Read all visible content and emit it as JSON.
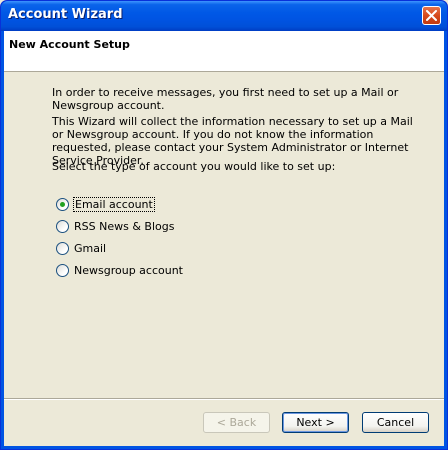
{
  "window": {
    "title": "Account Wizard"
  },
  "header": {
    "title": "New Account Setup"
  },
  "body": {
    "paragraph1": "In order to receive messages, you first need to set up a Mail or Newsgroup account.",
    "paragraph2": "This Wizard will collect the information necessary to set up a Mail or Newsgroup account. If you do not know the information requested, please contact your System Administrator or Internet Service Provider.",
    "prompt": "Select the type of account you would like to set up:"
  },
  "account_types": [
    {
      "label": "Email account",
      "selected": true
    },
    {
      "label": "RSS News & Blogs",
      "selected": false
    },
    {
      "label": "Gmail",
      "selected": false
    },
    {
      "label": "Newsgroup account",
      "selected": false
    }
  ],
  "buttons": {
    "back": "< Back",
    "next": "Next >",
    "cancel": "Cancel"
  },
  "colors": {
    "titlebar": "#0054e3",
    "dialog_bg": "#ece9d8",
    "radio_selected": "#21a121"
  }
}
